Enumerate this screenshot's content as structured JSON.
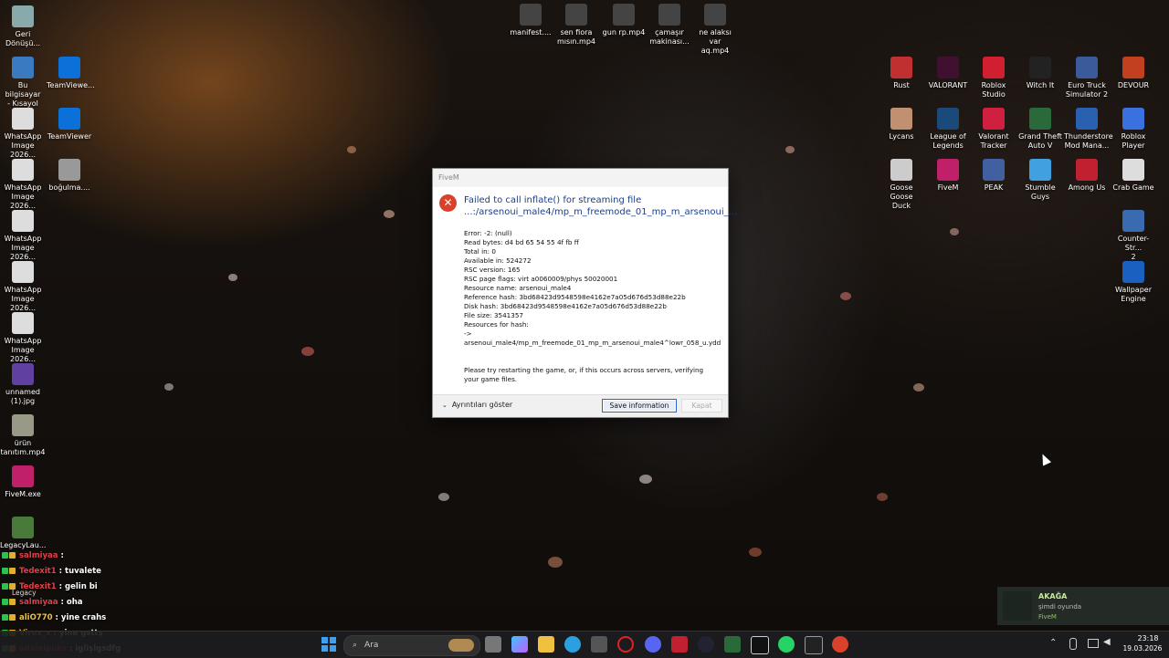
{
  "desktop_left_icons": [
    {
      "label": "Geri\nDönüşü...",
      "icon": "recycle-bin-icon"
    },
    {
      "label": "Bu bilgisayar\n- Kısayol",
      "icon": "pc-icon"
    },
    {
      "label": "TeamViewe...",
      "icon": "teamviewer-icon"
    },
    {
      "label": "WhatsApp\nImage 2026...",
      "icon": "image-file-icon"
    },
    {
      "label": "TeamViewer",
      "icon": "teamviewer-icon"
    },
    {
      "label": "WhatsApp\nImage 2026...",
      "icon": "image-file-icon"
    },
    {
      "label": "boğulma....",
      "icon": "video-file-icon"
    },
    {
      "label": "WhatsApp\nImage 2026...",
      "icon": "image-file-icon"
    },
    {
      "label": "WhatsApp\nImage 2026...",
      "icon": "image-file-icon"
    },
    {
      "label": "WhatsApp\nImage 2026...",
      "icon": "image-file-icon"
    },
    {
      "label": "unnamed\n(1).jpg",
      "icon": "image-file-icon"
    },
    {
      "label": "ürün\ntanıtım.mp4",
      "icon": "video-file-icon"
    },
    {
      "label": "FiveM.exe",
      "icon": "fivem-icon"
    },
    {
      "label": "LegacyLau...",
      "icon": "minecraft-icon"
    }
  ],
  "desktop_top_icons": [
    {
      "label": "manifest....",
      "icon": "file-icon"
    },
    {
      "label": "sen fiora\nmısın.mp4",
      "icon": "video-file-icon"
    },
    {
      "label": "gun rp.mp4",
      "icon": "video-file-icon"
    },
    {
      "label": "çamaşır\nmakinası...",
      "icon": "video-file-icon"
    },
    {
      "label": "ne alaksı var\naq.mp4",
      "icon": "video-file-icon"
    }
  ],
  "desktop_right_icons": [
    {
      "label": "Rust",
      "icon": "rust-icon"
    },
    {
      "label": "VALORANT",
      "icon": "valorant-icon"
    },
    {
      "label": "Roblox\nStudio",
      "icon": "roblox-studio-icon"
    },
    {
      "label": "Witch It",
      "icon": "witch-it-icon"
    },
    {
      "label": "Euro Truck\nSimulator 2",
      "icon": "ets2-icon"
    },
    {
      "label": "DEVOUR",
      "icon": "devour-icon"
    },
    {
      "label": "Lycans",
      "icon": "lycans-icon"
    },
    {
      "label": "League of\nLegends",
      "icon": "lol-icon"
    },
    {
      "label": "Valorant\nTracker",
      "icon": "tracker-icon"
    },
    {
      "label": "Grand Theft\nAuto V",
      "icon": "gta-icon"
    },
    {
      "label": "Thunderstore\nMod Mana...",
      "icon": "thunderstore-icon"
    },
    {
      "label": "Roblox Player",
      "icon": "roblox-icon"
    },
    {
      "label": "Goose Goose\nDuck",
      "icon": "goose-icon"
    },
    {
      "label": "FiveM",
      "icon": "fivem-icon"
    },
    {
      "label": "PEAK",
      "icon": "peak-icon"
    },
    {
      "label": "Stumble\nGuys",
      "icon": "stumble-icon"
    },
    {
      "label": "Among Us",
      "icon": "among-us-icon"
    },
    {
      "label": "Crab Game",
      "icon": "crab-game-icon"
    },
    {
      "label": "Counter-Str...\n2",
      "icon": "cs2-icon"
    },
    {
      "label": "Wallpaper\nEngine",
      "icon": "wallpaper-engine-icon"
    }
  ],
  "dialog": {
    "title": "FiveM",
    "heading": "Failed to call inflate() for streaming file ...:/arsenoui_male4/mp_m_freemode_01_mp_m_arsenoui_...",
    "body": "Error: -2: (null)\nRead bytes: d4 bd 65 54 55 4f fb ff\nTotal in: 0\nAvailable in: 524272\nRSC version: 165\nRSC page flags: virt a0060009/phys 50020001\nResource name: arsenoui_male4\nReference hash: 3bd68423d9548598e4162e7a05d676d53d88e22b\nDisk hash: 3bd68423d9548598e4162e7a05d676d53d88e22b\nFile size: 3541357\nResources for hash:\n->\narsenoui_male4/mp_m_freemode_01_mp_m_arsenoui_male4^lowr_058_u.ydd",
    "advice": "Please try restarting the game, or, if this occurs across servers, verifying your game files.",
    "details_label": "Ayrıntıları göster",
    "save_label": "Save information",
    "close_label": "Kapat"
  },
  "chat": [
    {
      "user": "salmiyaa",
      "msg": ":",
      "user_color": "#e0404a"
    },
    {
      "user": "Tedexit1",
      "msg": ": tuvalete",
      "user_color": "#e0404a"
    },
    {
      "user": "Tedexit1",
      "msg": ": gelin bi",
      "user_color": "#e0404a"
    },
    {
      "user": "salmiyaa",
      "msg": ": oha",
      "user_color": "#e0404a"
    },
    {
      "user": "aliO770",
      "msg": ": yine crahs",
      "user_color": "#e8c24a"
    },
    {
      "user": "Virox_x",
      "msg": ": yine gsttş",
      "user_color": "#e8a040"
    },
    {
      "user": "adalelpuks",
      "msg": ": iglişlgsdfg",
      "user_color": "#e0404a"
    }
  ],
  "chat_overlap_label": "Legacy",
  "notification": {
    "name": "AKAĞA",
    "status": "şimdi oyunda",
    "game": "FiveM"
  },
  "taskbar": {
    "search_placeholder": "Ara",
    "time": "23:18",
    "date": "19.03.2026"
  },
  "colors": {
    "dialog_heading": "#1a3f8f",
    "error_red": "#d9412b",
    "taskbar_bg": "#1c1c1e"
  }
}
